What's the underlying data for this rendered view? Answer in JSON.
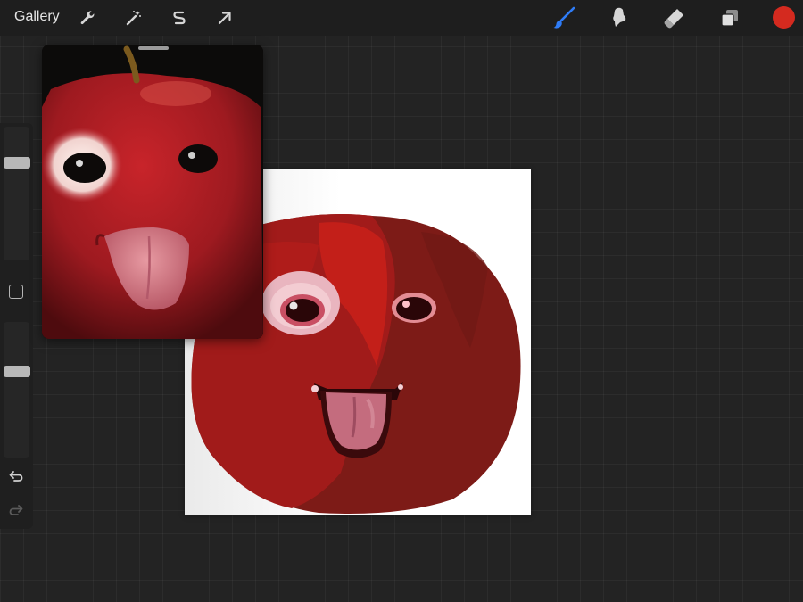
{
  "toolbar": {
    "gallery_label": "Gallery",
    "left_tools": [
      {
        "name": "actions-wrench-icon"
      },
      {
        "name": "adjustments-magic-wand-icon"
      },
      {
        "name": "selection-s-icon"
      },
      {
        "name": "transform-arrow-icon"
      }
    ],
    "right_tools": [
      {
        "name": "brush-icon",
        "active": true
      },
      {
        "name": "smudge-icon",
        "active": false
      },
      {
        "name": "eraser-icon",
        "active": false
      },
      {
        "name": "layers-icon",
        "active": false
      }
    ],
    "current_color": "#d42a1f",
    "active_tool_color": "#2f7cf6"
  },
  "sidebar": {
    "brush_size_level": 0.25,
    "opacity_level": 0.35,
    "icons": [
      "undo-icon",
      "redo-icon"
    ]
  },
  "colors": {
    "apple_red": "#a11b1a",
    "apple_dark": "#7d1b17",
    "tongue": "#c46c7e"
  }
}
